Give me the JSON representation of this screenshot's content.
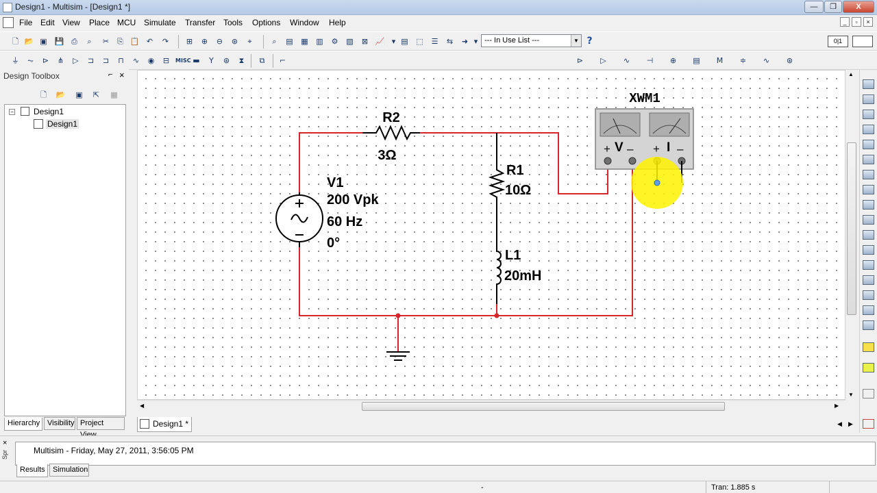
{
  "window": {
    "title": "Design1 - Multisim - [Design1 *]",
    "minimize": "—",
    "restore": "❐",
    "close": "X"
  },
  "menu": [
    "File",
    "Edit",
    "View",
    "Place",
    "MCU",
    "Simulate",
    "Transfer",
    "Tools",
    "Options",
    "Window",
    "Help"
  ],
  "toolbar": {
    "in_use_list": "--- In Use List ---",
    "help": "?"
  },
  "toolbox": {
    "title": "Design Toolbox",
    "pin": "⌐",
    "close": "×",
    "tree": {
      "root": "Design1",
      "child": "Design1"
    },
    "tabs": [
      "Hierarchy",
      "Visibility",
      "Project View"
    ]
  },
  "document_tab": "Design1 *",
  "circuit": {
    "source": {
      "name": "V1",
      "amplitude": "200 Vpk",
      "frequency": "60 Hz",
      "phase": "0°"
    },
    "r2": {
      "name": "R2",
      "value": "3Ω"
    },
    "r1": {
      "name": "R1",
      "value": "10Ω"
    },
    "l1": {
      "name": "L1",
      "value": "20mH"
    },
    "wattmeter": {
      "name": "XWM1",
      "v_label": "V",
      "i_label": "I",
      "plus": "+",
      "minus": "–"
    },
    "wire_color": "#d9252a",
    "cursor_highlight": "#fff200"
  },
  "spreadsheet": {
    "side_label": "Spr",
    "message": "Multisim  -  Friday, May 27, 2011, 3:56:05 PM",
    "tabs": [
      "Results",
      "Simulation"
    ]
  },
  "status": {
    "center": "-",
    "right": "Tran: 1.885 s"
  }
}
